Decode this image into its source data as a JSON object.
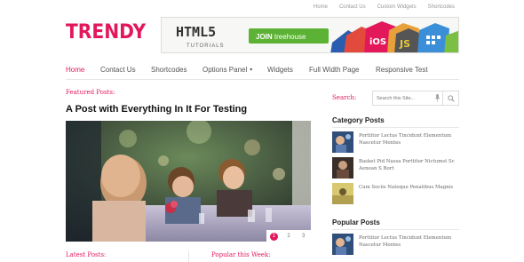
{
  "top_links": [
    "Home",
    "Contact Us",
    "Custom Widgets",
    "Shortcodes"
  ],
  "logo": "TRENDY",
  "banner": {
    "html5_title": "HTML5",
    "html5_sub": "TUTORIALS",
    "cta_prefix": "JOIN",
    "cta_brand": "treehouse",
    "badge_ios": "iOS",
    "badge_js": "JS"
  },
  "main_nav": [
    {
      "label": "Home",
      "active": true
    },
    {
      "label": "Contact Us",
      "active": false
    },
    {
      "label": "Shortcodes",
      "active": false
    },
    {
      "label": "Options Panel",
      "active": false,
      "dropdown": true
    },
    {
      "label": "Widgets",
      "active": false
    },
    {
      "label": "Full Width Page",
      "active": false
    },
    {
      "label": "Responsive Test",
      "active": false
    }
  ],
  "featured": {
    "label": "Featured Posts:",
    "title": "A Post with Everything In It For Testing",
    "slides": [
      "1",
      "2",
      "3"
    ],
    "active_slide": "1"
  },
  "bottom": {
    "latest_label": "Latest Posts:",
    "popular_week_label": "Popular this Week:"
  },
  "sidebar": {
    "search_label": "Search:",
    "search_placeholder": "Search this Site...",
    "category_title": "Category Posts",
    "category_posts": [
      "Porttitor Lectus Tincidunt Elementum Nascetur Montes",
      "Basket Pid Nassa Porttitor Nictumst Sc Aenean S Bort",
      "Cum Sociis Natoque Penatibus Magnis"
    ],
    "popular_title": "Popular Posts",
    "popular_posts": [
      "Porttitor Lectus Tincidunt Elementum Nascetur Montes"
    ]
  },
  "colors": {
    "accent": "#e2185b",
    "nav_text": "#555555",
    "muted": "#999999"
  }
}
